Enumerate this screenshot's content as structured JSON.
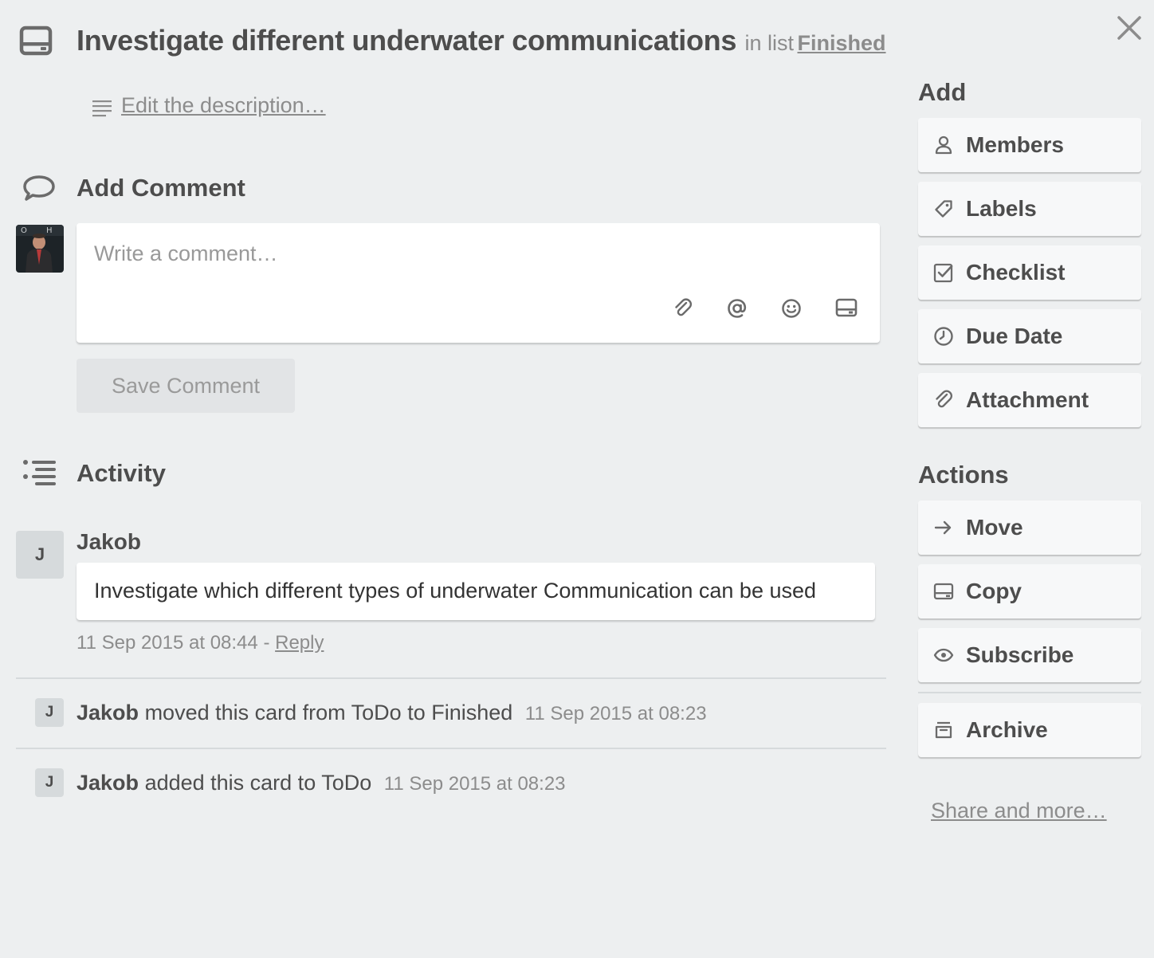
{
  "card": {
    "title": "Investigate different underwater communications",
    "in_list_prefix": "in list",
    "list_name": "Finished"
  },
  "description": {
    "link_text": "Edit the description…"
  },
  "comment": {
    "heading": "Add Comment",
    "placeholder": "Write a comment…",
    "save_label": "Save Comment"
  },
  "activity": {
    "heading": "Activity",
    "comment": {
      "author": "Jakob",
      "avatar_initial": "J",
      "text": "Investigate which different types of underwater Communication can be used",
      "timestamp": "11 Sep 2015 at 08:44",
      "separator": "-",
      "reply_label": "Reply"
    },
    "events": [
      {
        "avatar_initial": "J",
        "author": "Jakob",
        "action": "moved this card from ToDo to Finished",
        "timestamp": "11 Sep 2015 at 08:23"
      },
      {
        "avatar_initial": "J",
        "author": "Jakob",
        "action": "added this card to ToDo",
        "timestamp": "11 Sep 2015 at 08:23"
      }
    ]
  },
  "sidebar": {
    "add_heading": "Add",
    "add_buttons": [
      {
        "label": "Members",
        "icon": "person-icon"
      },
      {
        "label": "Labels",
        "icon": "tag-icon"
      },
      {
        "label": "Checklist",
        "icon": "checkbox-icon"
      },
      {
        "label": "Due Date",
        "icon": "clock-icon"
      },
      {
        "label": "Attachment",
        "icon": "paperclip-icon"
      }
    ],
    "actions_heading": "Actions",
    "action_buttons": [
      {
        "label": "Move",
        "icon": "arrow-right-icon"
      },
      {
        "label": "Copy",
        "icon": "card-icon"
      },
      {
        "label": "Subscribe",
        "icon": "eye-icon"
      },
      {
        "label": "Archive",
        "icon": "archive-icon"
      }
    ],
    "share_link": "Share and more…"
  },
  "colors": {
    "background": "#edeff0",
    "text": "#4d4d4d",
    "muted_text": "#8c8c8c",
    "button_bg": "#f7f8f9",
    "avatar_bg": "#d6dadc"
  }
}
